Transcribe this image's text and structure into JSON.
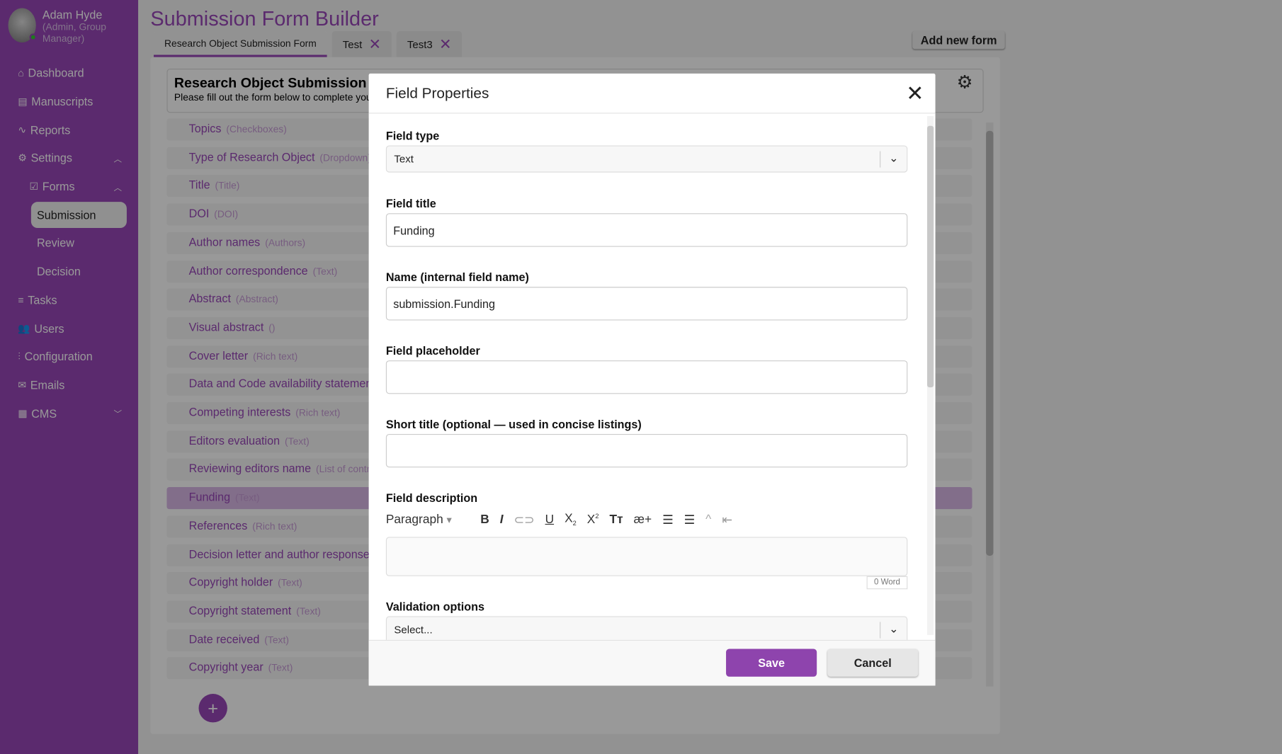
{
  "user": {
    "name": "Adam Hyde",
    "role": "(Admin, Group Manager)"
  },
  "nav": [
    {
      "label": "Dashboard",
      "icon": "home-icon"
    },
    {
      "label": "Manuscripts",
      "icon": "document-icon"
    },
    {
      "label": "Reports",
      "icon": "activity-icon"
    },
    {
      "label": "Settings",
      "icon": "gear-icon",
      "chevron": "^"
    },
    {
      "label": "Forms",
      "icon": "checkbox-icon",
      "chevron": "^"
    },
    {
      "label": "Submission",
      "active": true
    },
    {
      "label": "Review"
    },
    {
      "label": "Decision"
    },
    {
      "label": "Tasks",
      "icon": "list-icon"
    },
    {
      "label": "Users",
      "icon": "users-icon"
    },
    {
      "label": "Configuration",
      "icon": "sliders-icon"
    },
    {
      "label": "Emails",
      "icon": "mail-icon"
    },
    {
      "label": "CMS",
      "icon": "layout-icon",
      "chevron": "v"
    }
  ],
  "page": {
    "title": "Submission Form Builder",
    "add_form": "Add new form",
    "tabs": [
      {
        "label": "Research Object Submission Form",
        "active": true
      },
      {
        "label": "Test"
      },
      {
        "label": "Test3"
      }
    ]
  },
  "form": {
    "title": "Research Object Submission Form",
    "description": "Please fill out the form below to complete your submission",
    "fields": [
      {
        "label": "Topics",
        "type": "(Checkboxes)"
      },
      {
        "label": "Type of Research Object",
        "type": "(Dropdown)"
      },
      {
        "label": "Title",
        "type": "(Title)"
      },
      {
        "label": "DOI",
        "type": "(DOI)"
      },
      {
        "label": "Author names",
        "type": "(Authors)"
      },
      {
        "label": "Author correspondence",
        "type": "(Text)"
      },
      {
        "label": "Abstract",
        "type": "(Abstract)"
      },
      {
        "label": "Visual abstract",
        "type": "()"
      },
      {
        "label": "Cover letter",
        "type": "(Rich text)"
      },
      {
        "label": "Data and Code availability statement",
        "type": "(Rich text)"
      },
      {
        "label": "Competing interests",
        "type": "(Rich text)"
      },
      {
        "label": "Editors evaluation",
        "type": "(Text)"
      },
      {
        "label": "Reviewing editors name",
        "type": "(List of contributors)"
      },
      {
        "label": "Funding",
        "type": "(Text)",
        "selected": true
      },
      {
        "label": "References",
        "type": "(Rich text)"
      },
      {
        "label": "Decision letter and author response",
        "type": "(Rich text)"
      },
      {
        "label": "Copyright holder",
        "type": "(Text)"
      },
      {
        "label": "Copyright statement",
        "type": "(Text)"
      },
      {
        "label": "Date received",
        "type": "(Text)"
      },
      {
        "label": "Copyright year",
        "type": "(Text)"
      }
    ]
  },
  "modal": {
    "title": "Field Properties",
    "field_type_label": "Field type",
    "field_type_value": "Text",
    "field_title_label": "Field title",
    "field_title_value": "Funding",
    "name_label": "Name (internal field name)",
    "name_value": "submission.Funding",
    "placeholder_label": "Field placeholder",
    "placeholder_value": "",
    "short_title_label": "Short title (optional — used in concise listings)",
    "short_title_value": "",
    "description_label": "Field description",
    "paragraph": "Paragraph",
    "word_count": "0 Word",
    "validation_label": "Validation options",
    "validation_placeholder": "Select...",
    "save": "Save",
    "cancel": "Cancel"
  },
  "colors": {
    "accent": "#8e44ad"
  }
}
